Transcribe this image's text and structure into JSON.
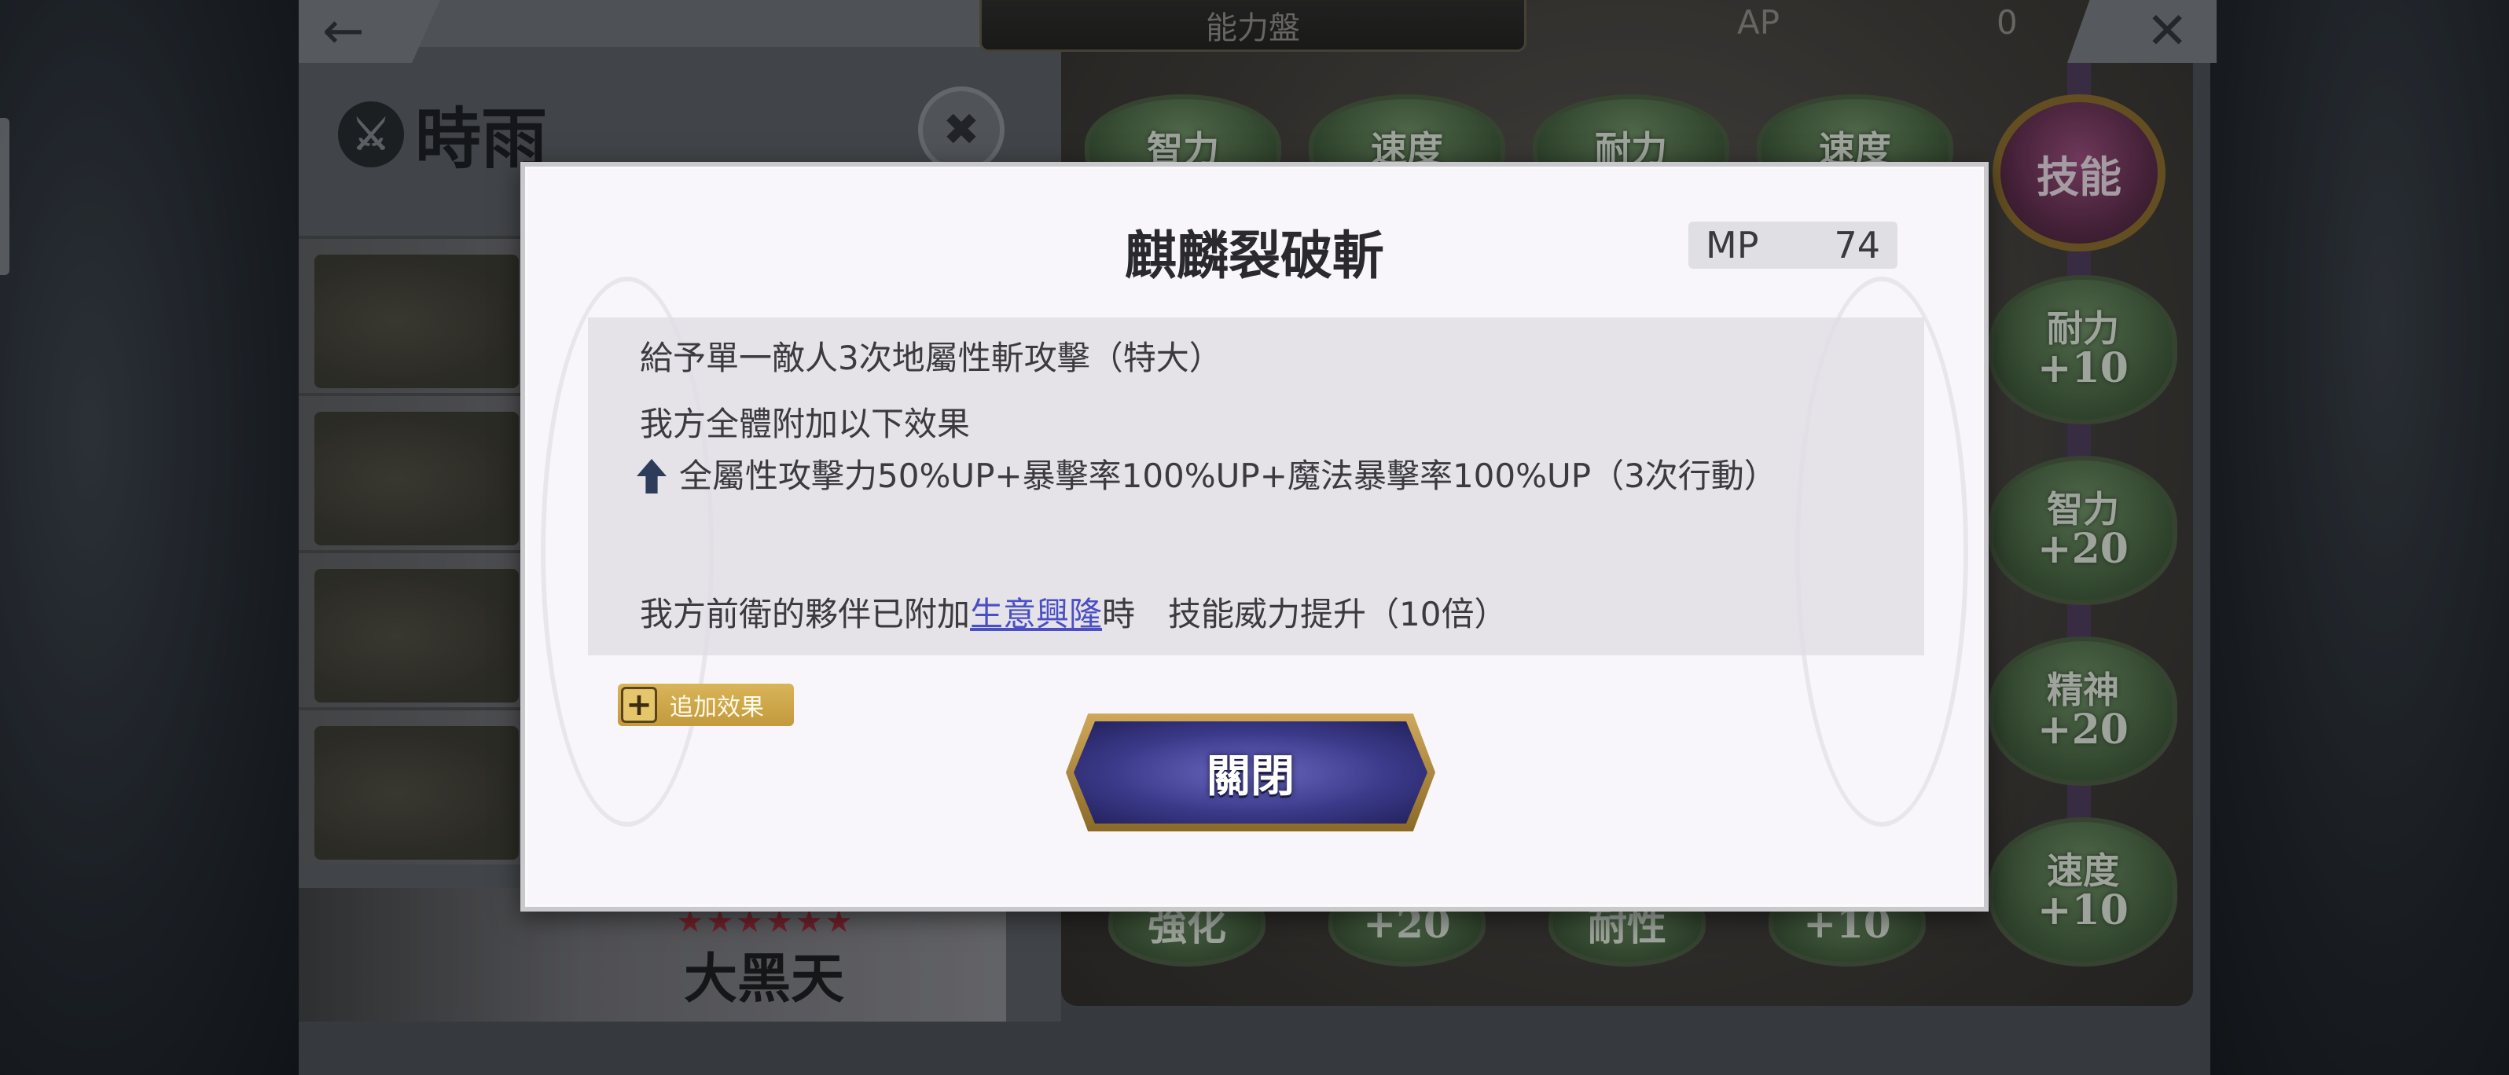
{
  "header": {
    "back_icon": "arrow-left-icon",
    "title": "能力盤",
    "ap_label": "AP",
    "ap_value": "0",
    "close_icon": "close-x-icon"
  },
  "character": {
    "name": "時雨",
    "unit_name": "大黑天",
    "stars": "★★★★★★"
  },
  "board": {
    "top_nodes": [
      "智力",
      "速度",
      "耐力",
      "速度"
    ],
    "skill_badge": "技能",
    "side_nodes": [
      {
        "label": "耐力",
        "value": "+10"
      },
      {
        "label": "智力",
        "value": "+20"
      },
      {
        "label": "精神",
        "value": "+20"
      },
      {
        "label": "速度",
        "value": "+10"
      }
    ],
    "bottom_nodes": [
      "強化",
      "+20",
      "耐性",
      "+10"
    ]
  },
  "modal": {
    "skill_name": "麒麟裂破斬",
    "mp_label": "MP",
    "mp_value": "74",
    "line1": "給予單一敵人3次地屬性斬攻擊（特大）",
    "line2": "我方全體附加以下效果",
    "line3": "全屬性攻擊力50%UP+暴擊率100%UP+魔法暴擊率100%UP（3次行動）",
    "extra_tag_label": "追加效果",
    "line4_prefix": "我方前衛的夥伴已附加",
    "line4_link": "生意興隆",
    "line4_suffix": "時　技能威力提升（10倍）",
    "close_label": "關閉"
  }
}
